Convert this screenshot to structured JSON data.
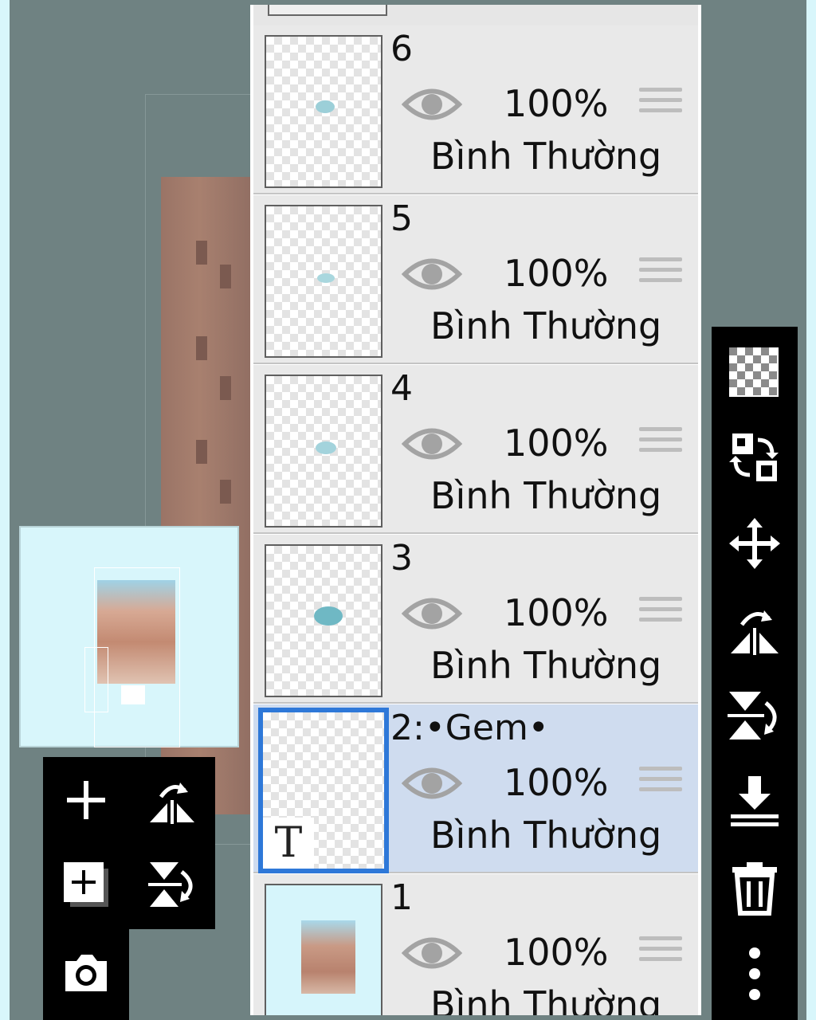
{
  "colors": {
    "selection_border": "#2e78d8",
    "selected_row": "#cfdcef",
    "row_bg": "#e9e9e9",
    "workspace_bg": "#6f8282",
    "toolbar_bg": "#000000"
  },
  "layers": [
    {
      "name": "6",
      "opacity": "100%",
      "blend": "Bình Thường",
      "visible_icon": "eye-icon"
    },
    {
      "name": "5",
      "opacity": "100%",
      "blend": "Bình Thường",
      "visible_icon": "eye-icon"
    },
    {
      "name": "4",
      "opacity": "100%",
      "blend": "Bình Thường",
      "visible_icon": "eye-icon"
    },
    {
      "name": "3",
      "opacity": "100%",
      "blend": "Bình Thường",
      "visible_icon": "eye-icon"
    },
    {
      "name": "2:•Gem•",
      "opacity": "100%",
      "blend": "Bình Thường",
      "visible_icon": "eye-icon",
      "selected": true,
      "thumb_badge": "T"
    },
    {
      "name": "1",
      "opacity": "100%",
      "blend": "Bình Thường",
      "visible_icon": "eye-icon"
    }
  ],
  "right_toolbar": [
    "transparency-checker-icon",
    "swap-layers-icon",
    "move-icon",
    "flip-horizontal-icon",
    "flip-vertical-icon",
    "merge-down-icon",
    "trash-icon",
    "more-vertical-icon"
  ],
  "left_toolbar": [
    "add-layer-icon",
    "flip-canvas-horizontal-icon",
    "add-layer-copy-icon",
    "flip-canvas-vertical-icon",
    "camera-icon"
  ]
}
